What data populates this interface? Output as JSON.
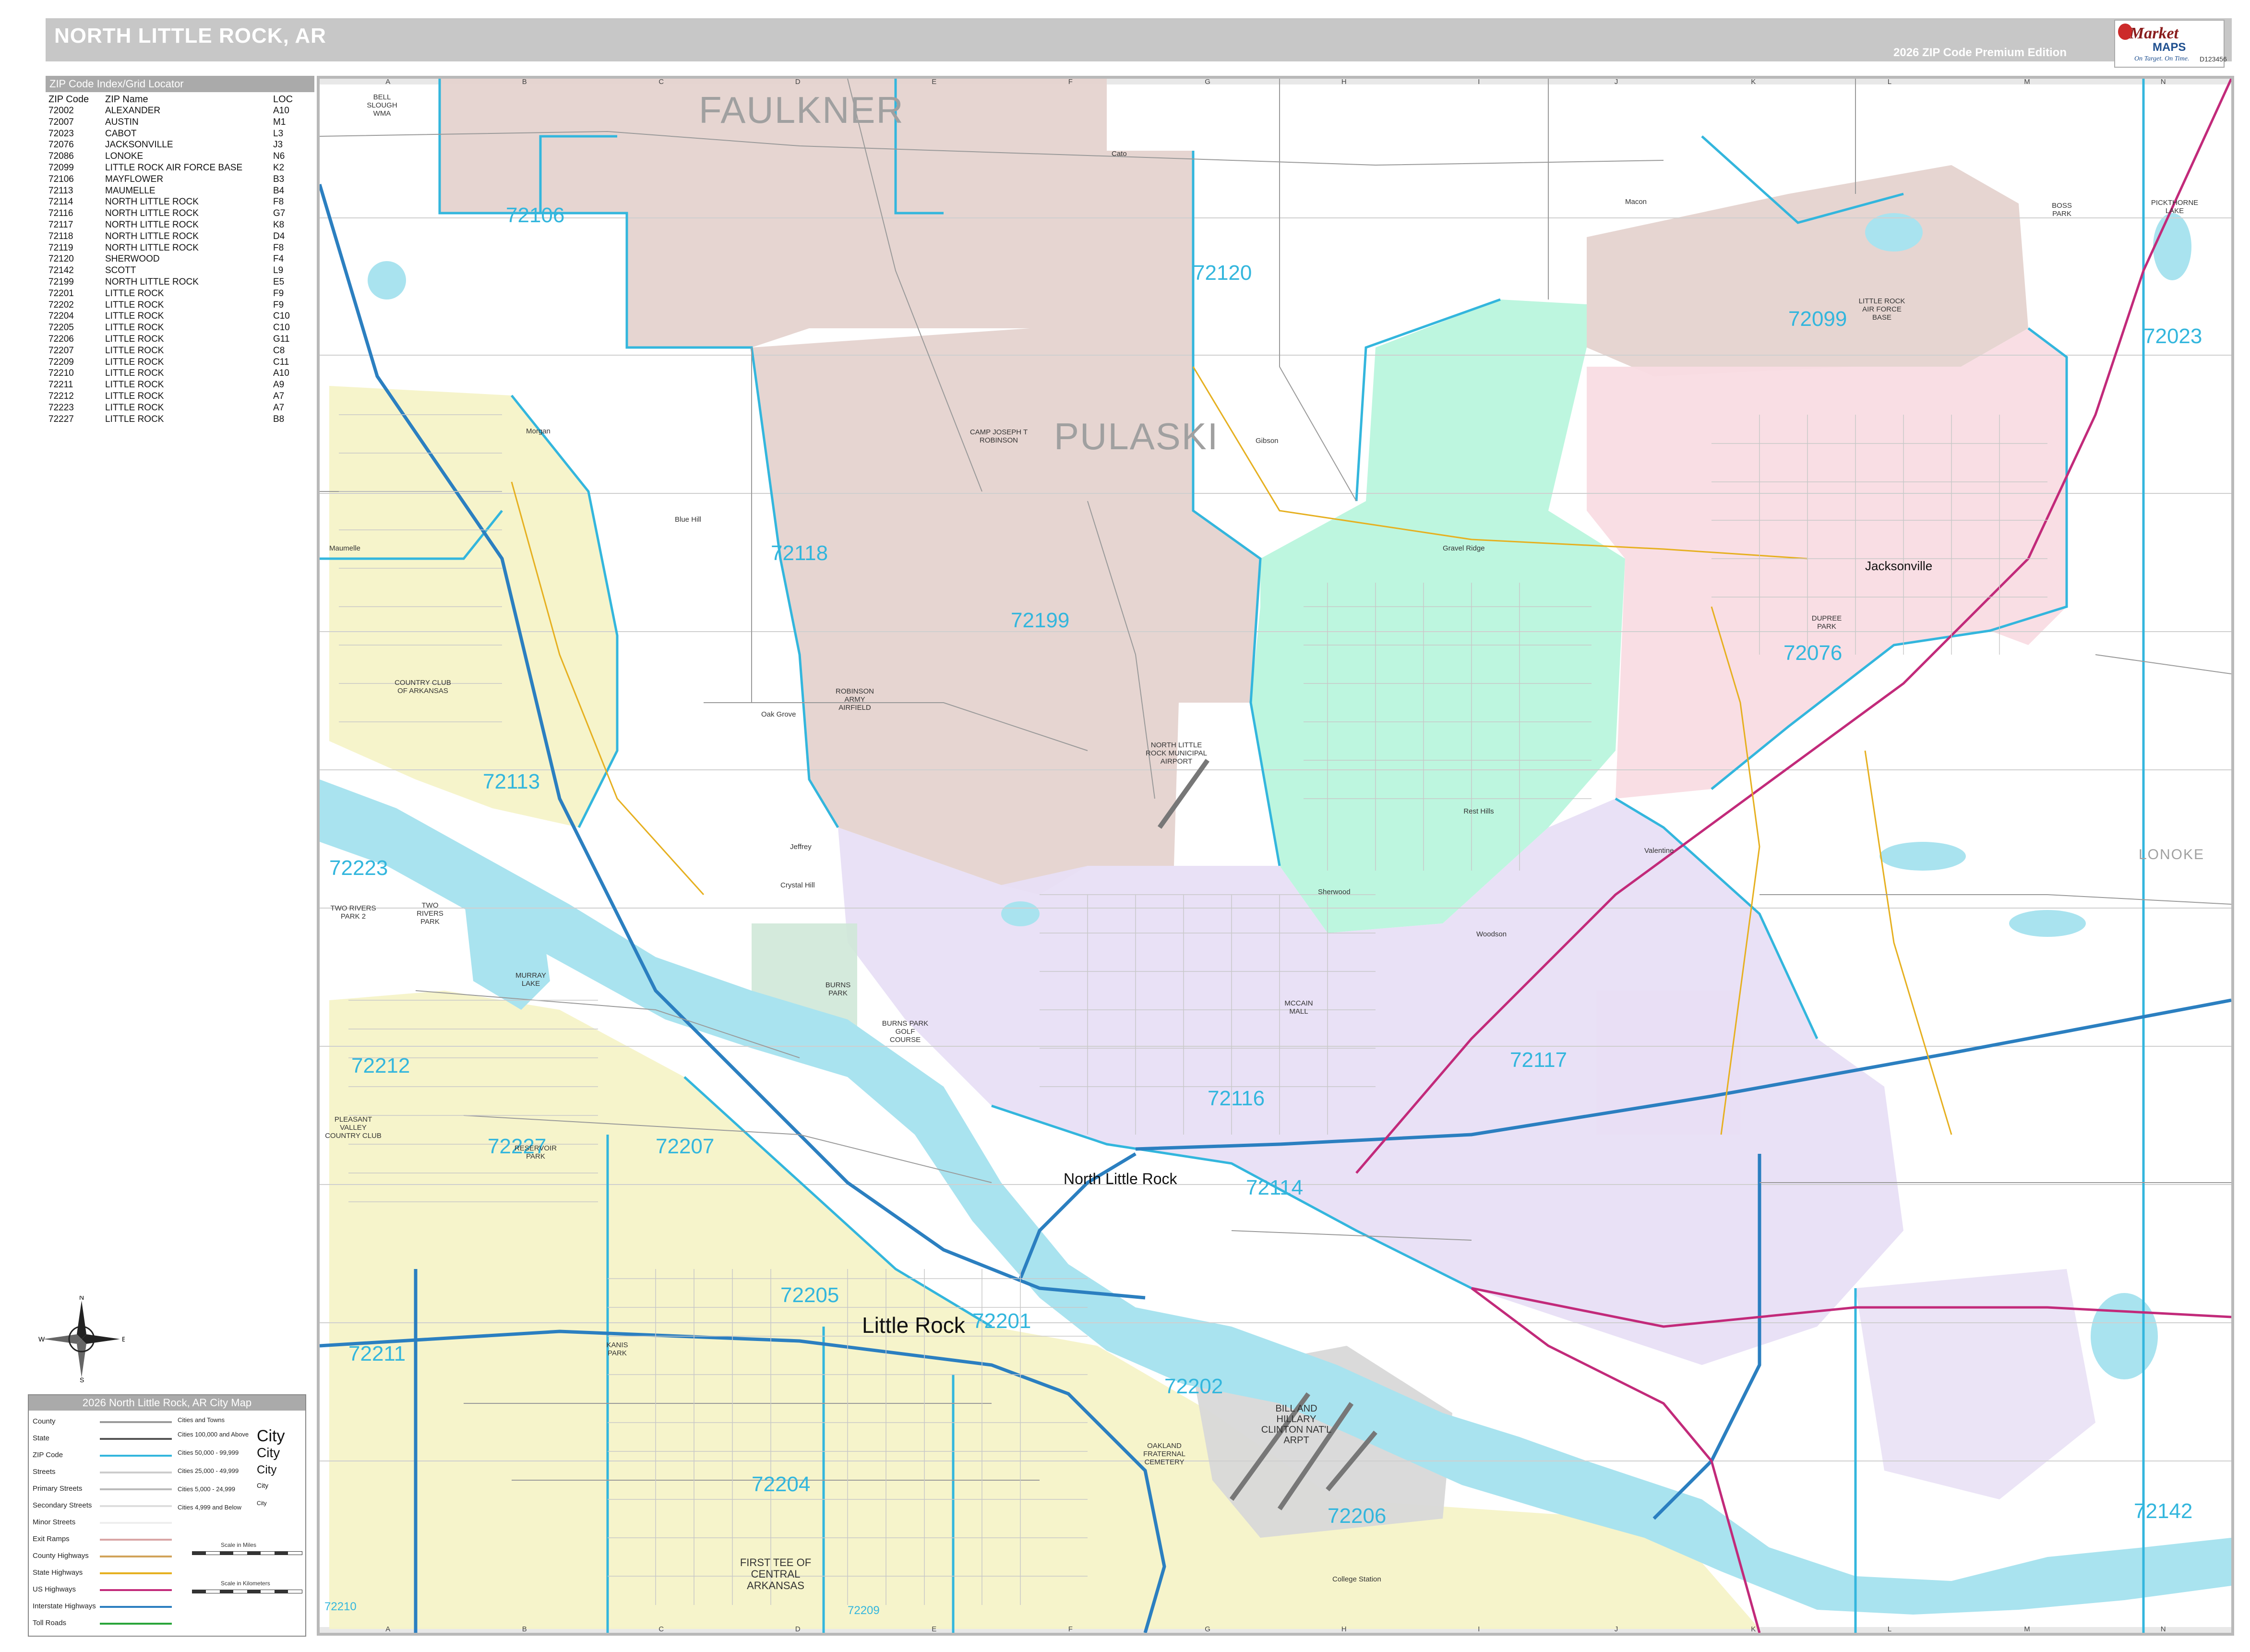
{
  "header": {
    "title": "NORTH LITTLE ROCK, AR",
    "edition": "2026 ZIP Code Premium Edition",
    "logo_brand": "Market",
    "logo_maps": "MAPS",
    "logo_tagline": "On Target. On Time.",
    "logo_code": "D123456"
  },
  "index": {
    "title": "ZIP Code Index/Grid Locator",
    "col_zip": "ZIP Code",
    "col_name": "ZIP Name",
    "col_loc": "LOC",
    "rows": [
      {
        "zip": "72002",
        "name": "ALEXANDER",
        "loc": "A10"
      },
      {
        "zip": "72007",
        "name": "AUSTIN",
        "loc": "M1"
      },
      {
        "zip": "72023",
        "name": "CABOT",
        "loc": "L3"
      },
      {
        "zip": "72076",
        "name": "JACKSONVILLE",
        "loc": "J3"
      },
      {
        "zip": "72086",
        "name": "LONOKE",
        "loc": "N6"
      },
      {
        "zip": "72099",
        "name": "LITTLE ROCK AIR FORCE BASE",
        "loc": "K2"
      },
      {
        "zip": "72106",
        "name": "MAYFLOWER",
        "loc": "B3"
      },
      {
        "zip": "72113",
        "name": "MAUMELLE",
        "loc": "B4"
      },
      {
        "zip": "72114",
        "name": "NORTH LITTLE ROCK",
        "loc": "F8"
      },
      {
        "zip": "72116",
        "name": "NORTH LITTLE ROCK",
        "loc": "G7"
      },
      {
        "zip": "72117",
        "name": "NORTH LITTLE ROCK",
        "loc": "K8"
      },
      {
        "zip": "72118",
        "name": "NORTH LITTLE ROCK",
        "loc": "D4"
      },
      {
        "zip": "72119",
        "name": "NORTH LITTLE ROCK",
        "loc": "F8"
      },
      {
        "zip": "72120",
        "name": "SHERWOOD",
        "loc": "F4"
      },
      {
        "zip": "72142",
        "name": "SCOTT",
        "loc": "L9"
      },
      {
        "zip": "72199",
        "name": "NORTH LITTLE ROCK",
        "loc": "E5"
      },
      {
        "zip": "72201",
        "name": "LITTLE ROCK",
        "loc": "F9"
      },
      {
        "zip": "72202",
        "name": "LITTLE ROCK",
        "loc": "F9"
      },
      {
        "zip": "72204",
        "name": "LITTLE ROCK",
        "loc": "C10"
      },
      {
        "zip": "72205",
        "name": "LITTLE ROCK",
        "loc": "C10"
      },
      {
        "zip": "72206",
        "name": "LITTLE ROCK",
        "loc": "G11"
      },
      {
        "zip": "72207",
        "name": "LITTLE ROCK",
        "loc": "C8"
      },
      {
        "zip": "72209",
        "name": "LITTLE ROCK",
        "loc": "C11"
      },
      {
        "zip": "72210",
        "name": "LITTLE ROCK",
        "loc": "A10"
      },
      {
        "zip": "72211",
        "name": "LITTLE ROCK",
        "loc": "A9"
      },
      {
        "zip": "72212",
        "name": "LITTLE ROCK",
        "loc": "A7"
      },
      {
        "zip": "72223",
        "name": "LITTLE ROCK",
        "loc": "A7"
      },
      {
        "zip": "72227",
        "name": "LITTLE ROCK",
        "loc": "B8"
      }
    ]
  },
  "legend": {
    "title": "2026 North Little Rock, AR City Map",
    "items": [
      {
        "label": "County",
        "color": "#9a9a9a"
      },
      {
        "label": "State",
        "color": "#555555"
      },
      {
        "label": "ZIP Code",
        "color": "#33b6dd"
      },
      {
        "label": "Streets",
        "color": "#cccccc"
      },
      {
        "label": "Primary Streets",
        "color": "#bbbbbb"
      },
      {
        "label": "Secondary Streets",
        "color": "#dddddd"
      },
      {
        "label": "Minor Streets",
        "color": "#eeeeee"
      },
      {
        "label": "Exit Ramps",
        "color": "#d9a5a5"
      },
      {
        "label": "County Highways",
        "color": "#d1a35a"
      },
      {
        "label": "State Highways",
        "color": "#e6b020"
      },
      {
        "label": "US Highways",
        "color": "#c22a7a"
      },
      {
        "label": "Interstate Highways",
        "color": "#2b7fc0"
      },
      {
        "label": "Toll Roads",
        "color": "#2aa53a"
      }
    ],
    "cities_header": "Cities and Towns",
    "city_classes": [
      {
        "label": "Cities 100,000 and Above",
        "sample": "City"
      },
      {
        "label": "Cities 50,000 - 99,999",
        "sample": "City"
      },
      {
        "label": "Cities 25,000 - 49,999",
        "sample": "City"
      },
      {
        "label": "Cities 5,000 - 24,999",
        "sample": "City"
      },
      {
        "label": "Cities 4,999 and Below",
        "sample": "City"
      }
    ],
    "scale_miles": "Scale in Miles",
    "scale_km": "Scale in Kilometers"
  },
  "compass": {
    "n": "N",
    "s": "S",
    "e": "E",
    "w": "W"
  },
  "map": {
    "grid_columns": [
      "A",
      "B",
      "C",
      "D",
      "E",
      "F",
      "G",
      "H",
      "I",
      "J",
      "K",
      "L",
      "M",
      "N"
    ],
    "grid_rows": [
      "1",
      "2",
      "3",
      "4",
      "5",
      "6",
      "7",
      "8",
      "9",
      "10",
      "11"
    ],
    "counties": [
      "FAULKNER",
      "PULASKI",
      "LONOKE"
    ],
    "cities": {
      "major": "Little Rock",
      "secondary": "North Little Rock",
      "minor": "Jacksonville",
      "towns": [
        "Sherwood",
        "Maumelle",
        "Gravel Ridge",
        "Jeffrey",
        "Oak Grove",
        "Blue Hill",
        "Cato",
        "Macon",
        "Gibson",
        "Valentine",
        "Woodson",
        "College Station",
        "Morgan",
        "Crystal Hill",
        "Rest Hills"
      ]
    },
    "zips": [
      "72106",
      "72120",
      "72099",
      "72023",
      "72118",
      "72199",
      "72076",
      "72113",
      "72223",
      "72212",
      "72227",
      "72207",
      "72116",
      "72117",
      "72114",
      "72205",
      "72201",
      "72211",
      "72202",
      "72204",
      "72206",
      "72142",
      "72210",
      "72209"
    ],
    "places": [
      "BELL SLOUGH WMA",
      "CAMP JOSEPH T ROBINSON",
      "LITTLE ROCK AIR FORCE BASE",
      "COUNTRY CLUB OF ARKANSAS",
      "TWO RIVERS PARK 2",
      "TWO RIVERS PARK",
      "MURRAY LAKE",
      "BURNS PARK",
      "BURNS PARK GOLF COURSE",
      "PLEASANT VALLEY COUNTRY CLUB",
      "RESERVOIR PARK",
      "NORTH LITTLE ROCK MUNICIPAL AIRPORT",
      "DUPREE PARK",
      "BILL AND HILLARY CLINTON NAT'L ARPT",
      "FIRST TEE OF CENTRAL ARKANSAS",
      "ROBINSON ARMY AIRFIELD",
      "PICKTHORNE LAKE",
      "BOSS PARK",
      "MCCAIN MALL",
      "KANIS PARK",
      "OAKLAND FRATERNAL CEMETERY"
    ]
  }
}
